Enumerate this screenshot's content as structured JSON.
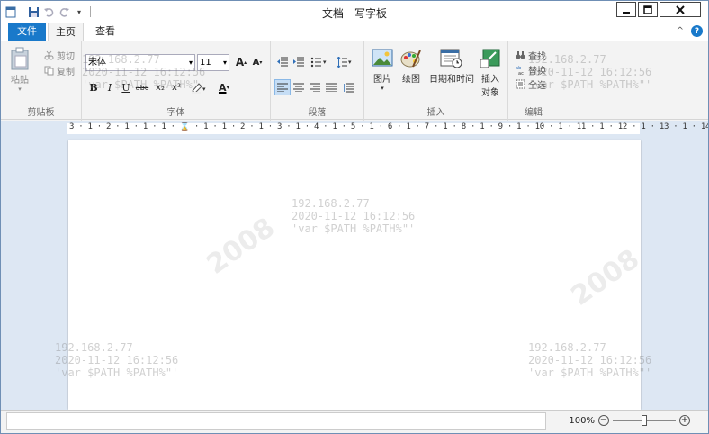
{
  "window": {
    "title": "文档 - 写字板",
    "controls": {
      "minimize": "—",
      "maximize": "☐",
      "close": "✕"
    }
  },
  "tabs": {
    "file": "文件",
    "home": "主页",
    "view": "查看"
  },
  "ribbon": {
    "clipboard": {
      "label": "剪贴板",
      "paste": "粘贴",
      "cut": "剪切",
      "copy": "复制"
    },
    "font": {
      "label": "字体",
      "family": "宋体",
      "size": "11",
      "grow": "A",
      "shrink": "A",
      "bold": "B",
      "italic": "I",
      "underline": "U",
      "strike": "abc",
      "subscript": "x₂",
      "superscript": "x²",
      "color": "A"
    },
    "paragraph": {
      "label": "段落"
    },
    "insert": {
      "label": "插入",
      "picture": "图片",
      "paint": "绘图",
      "datetime": "日期和时间",
      "object_line1": "插入",
      "object_line2": "对象"
    },
    "editing": {
      "label": "编辑",
      "find": "查找",
      "replace": "替换",
      "select_all": "全选"
    }
  },
  "ruler": {
    "text": "3 · 1 · 2 · 1 · 1 · 1 · ⌛ · 1 · 1 · 2 · 1 · 3 · 1 · 4 · 1 · 5 · 1 · 6 · 1 · 7 · 1 · 8 · 1 · 9 · 1 · 10 · 1 · 11 · 1 · 12 · 1 · 13 · 1 · 14 · 15 · 1 · 16 · 1 · 17 · 1"
  },
  "status": {
    "zoom": "100%",
    "zoom_out": "−",
    "zoom_in": "+"
  },
  "watermark": {
    "ip": "192.168.2.77",
    "time": "2020-11-12 16:12:56",
    "var": "'var $PATH %PATH%\"'",
    "brand": "2008"
  }
}
